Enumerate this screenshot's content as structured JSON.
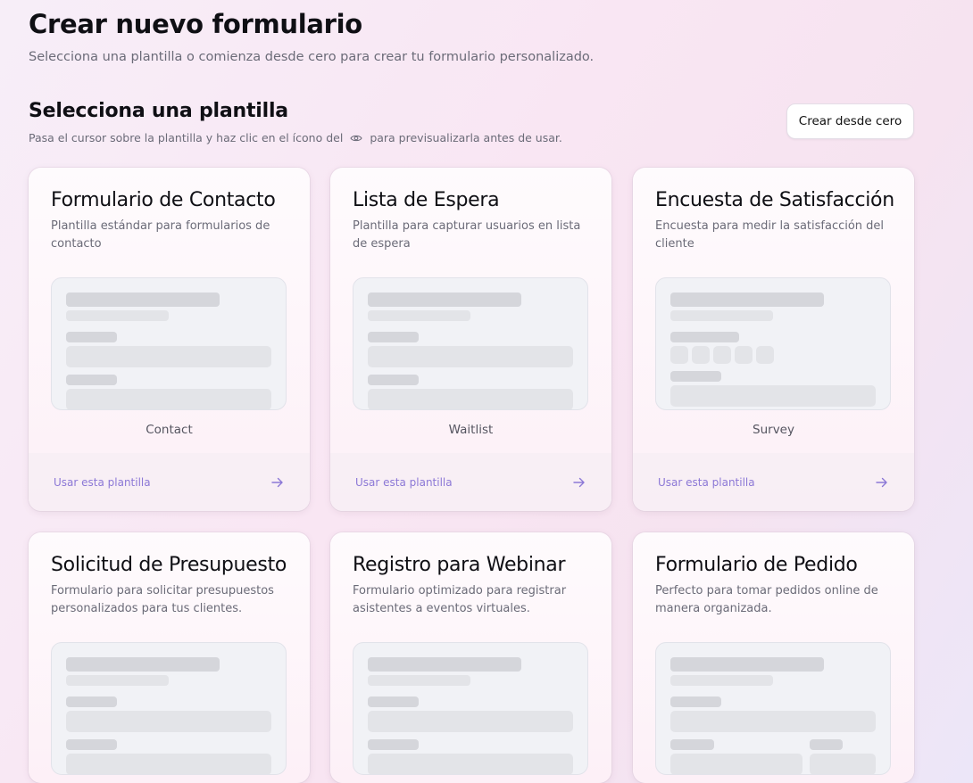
{
  "header": {
    "title": "Crear nuevo formulario",
    "subtitle": "Selecciona una plantilla o comienza desde cero para crear tu formulario personalizado."
  },
  "templates_section": {
    "title": "Selecciona una plantilla",
    "hint_before": "Pasa el cursor sobre la plantilla y haz clic en el ícono del",
    "hint_after": "para previsualizarla antes de usar.",
    "create_from_scratch_label": "Crear desde cero"
  },
  "templates": [
    {
      "title": "Formulario de Contacto",
      "description": "Plantilla estándar para formularios de contacto",
      "preview_label": "Contact",
      "use_label": "Usar esta plantilla"
    },
    {
      "title": "Lista de Espera",
      "description": "Plantilla para capturar usuarios en lista de espera",
      "preview_label": "Waitlist",
      "use_label": "Usar esta plantilla"
    },
    {
      "title": "Encuesta de Satisfacción",
      "description": "Encuesta para medir la satisfacción del cliente",
      "preview_label": "Survey",
      "use_label": "Usar esta plantilla"
    },
    {
      "title": "Solicitud de Presupuesto",
      "description": "Formulario para solicitar presupuestos personalizados para tus clientes."
    },
    {
      "title": "Registro para Webinar",
      "description": "Formulario optimizado para registrar asistentes a eventos virtuales."
    },
    {
      "title": "Formulario de Pedido",
      "description": "Perfecto para tomar pedidos online de manera organizada."
    }
  ],
  "icons": {
    "hint_icon": "eye-icon",
    "footer_icon": "arrow-right-icon"
  },
  "colors": {
    "accent": "#8c78d6",
    "skeleton_dark": "#d5d6db",
    "skeleton_light": "#e3e4e8"
  }
}
